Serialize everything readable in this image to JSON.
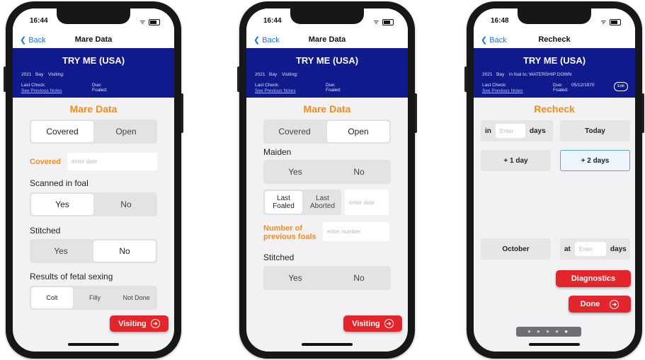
{
  "status": {
    "time1": "16:44",
    "time2": "16:44",
    "time3": "16:48"
  },
  "nav": {
    "back": "Back",
    "title1": "Mare Data",
    "title2": "Mare Data",
    "title3": "Recheck"
  },
  "horse": {
    "name": "TRY ME (USA)",
    "year": "2021",
    "color": "Bay",
    "visiting": "Visiting:",
    "in_foal": "in foal to: WATERSHIP DOWN",
    "last_check": "Last Check:",
    "see_notes": "See Previous Notes",
    "due": "Due:",
    "due_date": "05/12/1970",
    "foaled": "Foaled:",
    "edit": "Edit"
  },
  "screen1": {
    "section_title": "Mare Data",
    "covered_open": [
      "Covered",
      "Open"
    ],
    "covered_label": "Covered",
    "date_placeholder": "enter date",
    "scanned_label": "Scanned in foal",
    "scanned_opts": [
      "Yes",
      "No"
    ],
    "stitched_label": "Stitched",
    "stitched_opts": [
      "Yes",
      "No"
    ],
    "fetal_label": "Results of fetal sexing",
    "fetal_opts": [
      "Colt",
      "Filly",
      "Not Done"
    ],
    "visiting_btn": "Visiting"
  },
  "screen2": {
    "section_title": "Mare Data",
    "covered_open": [
      "Covered",
      "Open"
    ],
    "maiden_label": "Maiden",
    "maiden_opts": [
      "Yes",
      "No"
    ],
    "last_opts": [
      "Last Foaled",
      "Last Aborted"
    ],
    "date_placeholder": "enter date",
    "prev_foals_label": "Number of previous foals",
    "number_placeholder": "enter number",
    "stitched_label": "Stitched",
    "stitched_opts": [
      "Yes",
      "No"
    ],
    "visiting_btn": "Visiting"
  },
  "screen3": {
    "section_title": "Recheck",
    "in_label": "in",
    "enter_placeholder": "Enter",
    "days_label": "days",
    "today_btn": "Today",
    "plus1_btn": "+ 1 day",
    "plus2_btn": "+ 2 days",
    "october_btn": "October",
    "at_label": "at",
    "diagnostics_btn": "Diagnostics",
    "done_btn": "Done"
  },
  "icons": {
    "arrow": "circle-arrow-right-icon",
    "chevron": "chevron-left-icon"
  },
  "colors": {
    "header": "#111a8c",
    "accent": "#f08c1e",
    "danger": "#e3262b",
    "link": "#1a73e8"
  }
}
